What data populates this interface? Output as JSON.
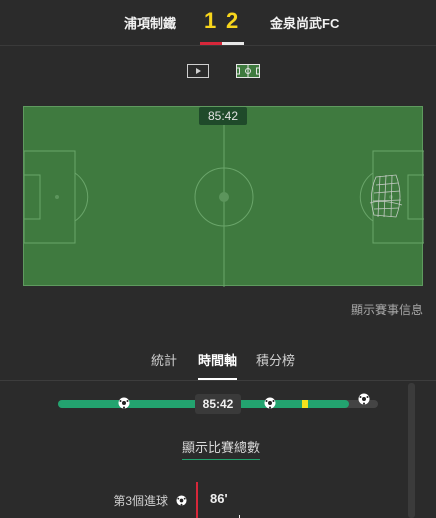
{
  "match": {
    "home_team": "浦項制鐵",
    "away_team": "金泉尚武FC",
    "home_score": "1",
    "away_score": "2"
  },
  "view_toggle": {
    "video_icon": "video-icon",
    "pitch_icon": "pitch-icon",
    "active": "pitch"
  },
  "pitch": {
    "clock": "85:42",
    "event_info_label": "顯示賽事信息"
  },
  "tabs": [
    {
      "label": "統計"
    },
    {
      "label": "時間軸",
      "active": true
    },
    {
      "label": "積分榜"
    }
  ],
  "timeline": {
    "time": "85:42",
    "progress_minutes": 85.7,
    "total_minutes": 90,
    "events": [
      {
        "type": "goal",
        "icon": "soccer-ball-icon"
      },
      {
        "type": "goal",
        "icon": "soccer-ball-icon"
      },
      {
        "type": "yellow-card",
        "icon": "yellow-card-icon"
      },
      {
        "type": "goal",
        "icon": "soccer-ball-icon"
      }
    ]
  },
  "show_total_label": "顯示比賽總數",
  "event_list": [
    {
      "label": "第3個進球",
      "minute": "86'",
      "icon": "soccer-ball-icon"
    }
  ],
  "colors": {
    "background": "#2b2b2b",
    "pitch": "#3f7a3f",
    "accent_green": "#23a36f",
    "score_yellow": "#f7d51c",
    "home_red": "#d7273a"
  }
}
